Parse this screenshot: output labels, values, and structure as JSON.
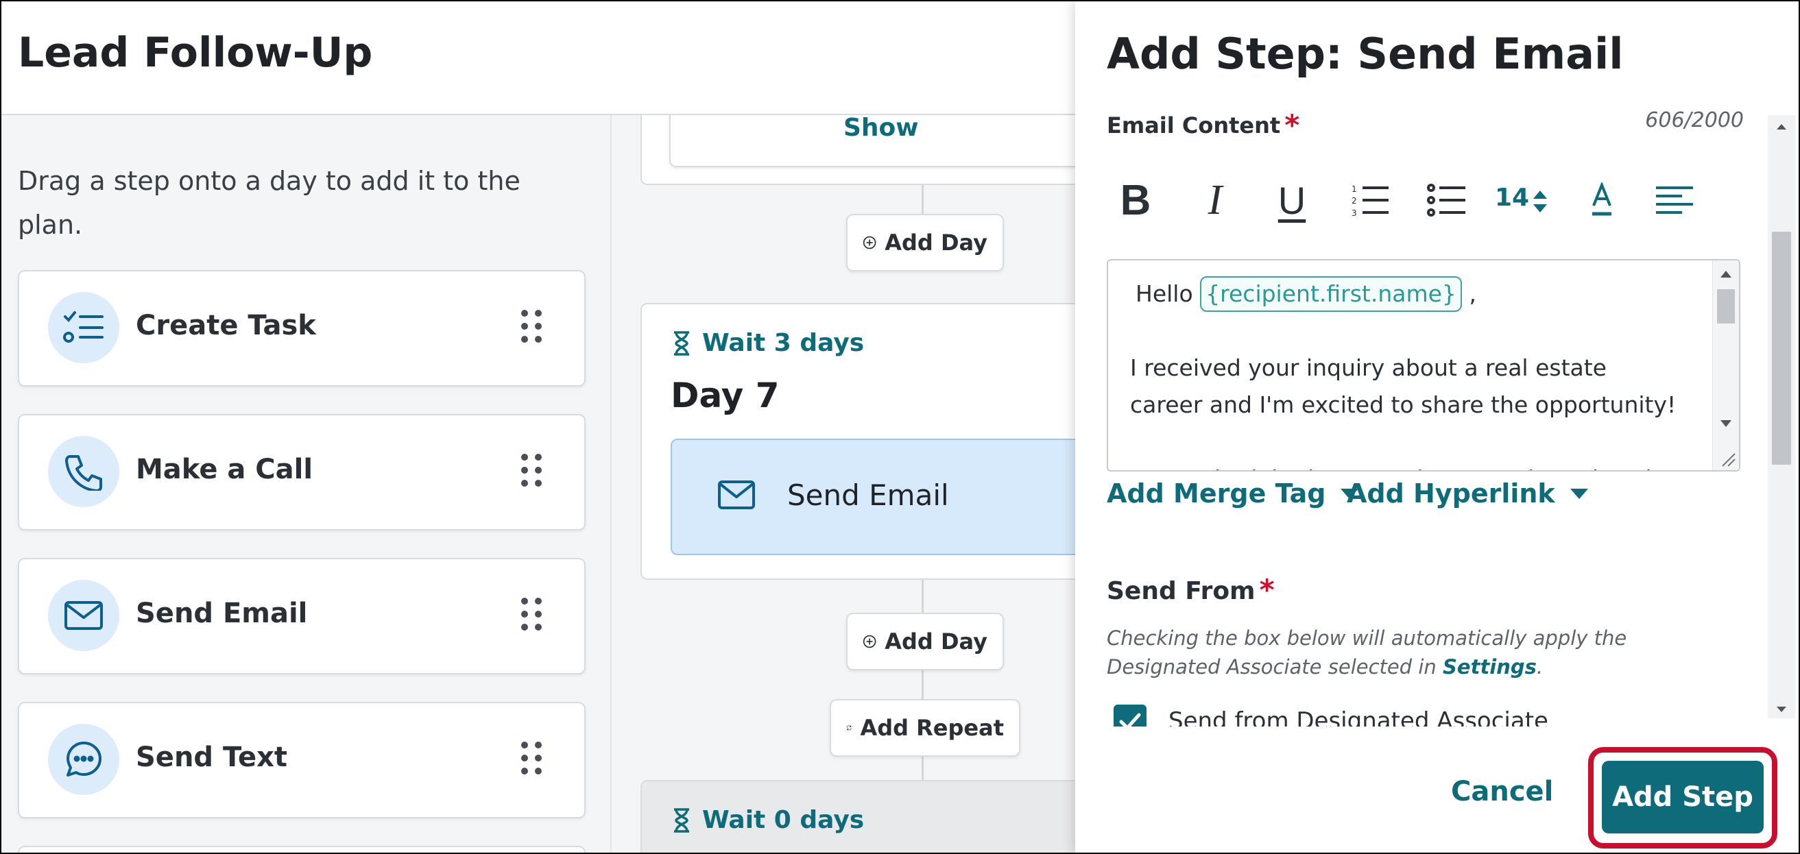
{
  "header": {
    "title": "Lead Follow-Up"
  },
  "palette": {
    "hint": "Drag a step onto a day to add it to the plan.",
    "items": [
      {
        "label": "Create Task",
        "icon": "checklist-icon"
      },
      {
        "label": "Make a Call",
        "icon": "phone-icon"
      },
      {
        "label": "Send Email",
        "icon": "envelope-icon"
      },
      {
        "label": "Send Text",
        "icon": "chat-bubble-icon"
      }
    ]
  },
  "timeline": {
    "show_link": "Show",
    "add_day_label": "Add Day",
    "add_repeat_label": "Add Repeat",
    "day7": {
      "wait": "Wait 3 days",
      "title": "Day 7",
      "step_label": "Send Email"
    },
    "next": {
      "wait": "Wait 0 days"
    }
  },
  "drawer": {
    "title": "Add Step: Send Email",
    "email_content_label": "Email Content",
    "required_mark": "*",
    "char_count": "606/2000",
    "toolbar": {
      "font_size": "14"
    },
    "editor": {
      "greeting": "Hello",
      "merge_tag": "{recipient.first.name}",
      "after_tag": ",",
      "paragraph1": "I received your inquiry about a real estate career and I'm excited to share the opportunity!",
      "paragraph2_partial": "Let's schedule time together to review what the"
    },
    "add_merge_tag": "Add Merge Tag",
    "add_hyperlink": "Add Hyperlink",
    "send_from_label": "Send From",
    "helper_text": "Checking the box below will automatically apply the Designated Associate selected in",
    "helper_link": "Settings",
    "helper_end": ".",
    "checkbox_label": "Send from Designated Associate",
    "checkbox_checked": true,
    "cancel": "Cancel",
    "add_step": "Add Step"
  },
  "colors": {
    "teal": "#0e6b7a",
    "highlight": "#c8102e",
    "step_blue": "#dcecfb"
  }
}
